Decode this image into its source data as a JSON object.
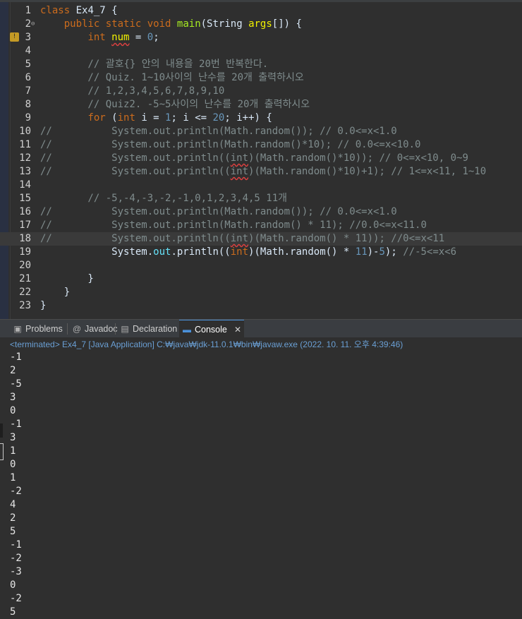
{
  "editor": {
    "lines": [
      {
        "num": "1",
        "tokens": [
          [
            "kw",
            "class"
          ],
          [
            "plain",
            " Ex4_7 {"
          ]
        ]
      },
      {
        "num": "2",
        "fold": "⊖",
        "tokens": [
          [
            "plain",
            "    "
          ],
          [
            "kw",
            "public"
          ],
          [
            "plain",
            " "
          ],
          [
            "kw",
            "static"
          ],
          [
            "plain",
            " "
          ],
          [
            "kw",
            "void"
          ],
          [
            "plain",
            " "
          ],
          [
            "meth",
            "main"
          ],
          [
            "plain",
            "(String "
          ],
          [
            "var",
            "args"
          ],
          [
            "plain",
            "[]) {"
          ]
        ]
      },
      {
        "num": "3",
        "warn": true,
        "tokens": [
          [
            "plain",
            "        "
          ],
          [
            "kw",
            "int"
          ],
          [
            "plain",
            " "
          ],
          [
            "var squig",
            "num"
          ],
          [
            "plain",
            " = "
          ],
          [
            "num",
            "0"
          ],
          [
            "plain",
            ";"
          ]
        ]
      },
      {
        "num": "4",
        "tokens": []
      },
      {
        "num": "5",
        "tokens": [
          [
            "cm",
            "        // 괄호{} 안의 내용을 20번 반복한다."
          ]
        ]
      },
      {
        "num": "6",
        "tokens": [
          [
            "cm",
            "        // Quiz. 1~10사이의 난수를 20개 출력하시오"
          ]
        ]
      },
      {
        "num": "7",
        "tokens": [
          [
            "cm",
            "        // 1,2,3,4,5,6,7,8,9,10"
          ]
        ]
      },
      {
        "num": "8",
        "tokens": [
          [
            "cm",
            "        // Quiz2. -5~5사이의 난수를 20개 출력하시오"
          ]
        ]
      },
      {
        "num": "9",
        "tokens": [
          [
            "plain",
            "        "
          ],
          [
            "kw",
            "for"
          ],
          [
            "plain",
            " ("
          ],
          [
            "kw",
            "int"
          ],
          [
            "plain",
            " i = "
          ],
          [
            "num",
            "1"
          ],
          [
            "plain",
            "; i <= "
          ],
          [
            "num",
            "20"
          ],
          [
            "plain",
            "; i++) {"
          ]
        ]
      },
      {
        "num": "10",
        "tokens": [
          [
            "cm",
            "//          System.out.println(Math.random()); // 0.0<=x<1.0"
          ]
        ]
      },
      {
        "num": "11",
        "tokens": [
          [
            "cm",
            "//          System.out.println(Math.random()*10); // 0.0<=x<10.0"
          ]
        ]
      },
      {
        "num": "12",
        "tokens": [
          [
            "cm",
            "//          System.out.println(("
          ],
          [
            "cm squig",
            "int"
          ],
          [
            "cm",
            ")(Math.random()*10)); // 0<=x<10, 0~9"
          ]
        ]
      },
      {
        "num": "13",
        "tokens": [
          [
            "cm",
            "//          System.out.println(("
          ],
          [
            "cm squig",
            "int"
          ],
          [
            "cm",
            ")(Math.random()*10)+1); // 1<=x<11, 1~10"
          ]
        ]
      },
      {
        "num": "14",
        "tokens": []
      },
      {
        "num": "15",
        "tokens": [
          [
            "cm",
            "        // -5,-4,-3,-2,-1,0,1,2,3,4,5 11개"
          ]
        ]
      },
      {
        "num": "16",
        "tokens": [
          [
            "cm",
            "//          System.out.println(Math.random()); // 0.0<=x<1.0"
          ]
        ]
      },
      {
        "num": "17",
        "tokens": [
          [
            "cm",
            "//          System.out.println(Math.random() * 11); //0.0<=x<11.0"
          ]
        ]
      },
      {
        "num": "18",
        "current": true,
        "tokens": [
          [
            "cm",
            "//          System.out.println(("
          ],
          [
            "cm squig",
            "int"
          ],
          [
            "cm",
            ")(Math.random() * 11)); //0<=x<11"
          ]
        ]
      },
      {
        "num": "19",
        "tokens": [
          [
            "plain",
            "            System."
          ],
          [
            "fld",
            "out"
          ],
          [
            "plain",
            ".println(("
          ],
          [
            "kw",
            "int"
          ],
          [
            "plain",
            ")(Math.random() * "
          ],
          [
            "num",
            "11"
          ],
          [
            "plain",
            ")-"
          ],
          [
            "num",
            "5"
          ],
          [
            "plain",
            "); "
          ],
          [
            "cm",
            "//-5<=x<6"
          ]
        ]
      },
      {
        "num": "20",
        "tokens": []
      },
      {
        "num": "21",
        "tokens": [
          [
            "plain",
            "        }"
          ]
        ]
      },
      {
        "num": "22",
        "tokens": [
          [
            "plain",
            "    }"
          ]
        ]
      },
      {
        "num": "23",
        "tokens": [
          [
            "plain",
            "}"
          ]
        ]
      }
    ]
  },
  "tabs": [
    {
      "label": "Problems",
      "icon": "problems-icon",
      "glyph": "▣",
      "active": false
    },
    {
      "label": "Javadoc",
      "icon": "javadoc-icon",
      "glyph": "@",
      "active": false
    },
    {
      "label": "Declaration",
      "icon": "declaration-icon",
      "glyph": "▤",
      "active": false
    },
    {
      "label": "Console",
      "icon": "console-icon",
      "glyph": "▬",
      "active": true,
      "close": "✕"
    }
  ],
  "console": {
    "status": "<terminated> Ex4_7 [Java Application] C:₩java₩jdk-11.0.1₩bin₩javaw.exe (2022. 10. 11. 오후 4:39:46)",
    "output": [
      "-1",
      "2",
      "-5",
      "3",
      "0",
      "-1",
      "3",
      "1",
      "0",
      "1",
      "-2",
      "4",
      "2",
      "5",
      "-1",
      "-2",
      "-3",
      "0",
      "-2",
      "5"
    ]
  },
  "colors": {
    "background": "#2f2f2f",
    "keyword": "#cc6c1d",
    "comment": "#7f8c8d",
    "number": "#6897bb",
    "method": "#a7ec21",
    "field": "#66e1f8",
    "status_link": "#6a9fd4"
  }
}
